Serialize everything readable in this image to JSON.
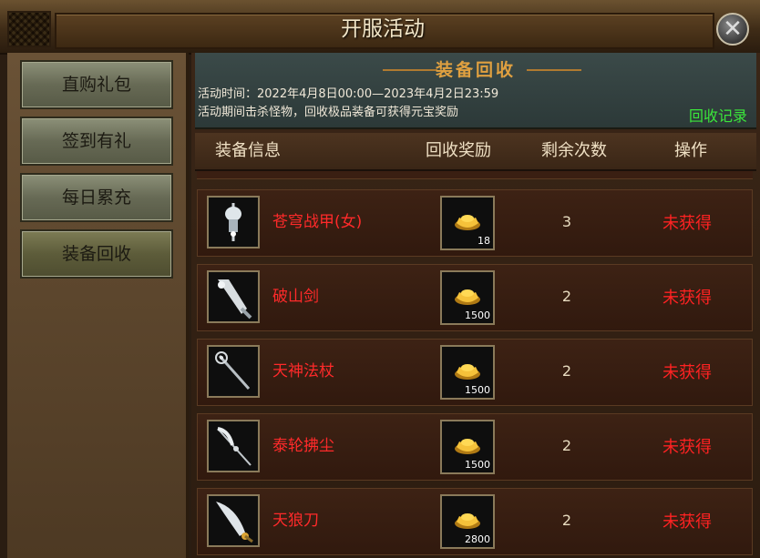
{
  "window": {
    "title": "开服活动"
  },
  "sidebar": {
    "items": [
      {
        "label": "直购礼包",
        "active": false
      },
      {
        "label": "签到有礼",
        "active": false
      },
      {
        "label": "每日累充",
        "active": false
      },
      {
        "label": "装备回收",
        "active": true
      }
    ]
  },
  "banner": {
    "title": "装备回收",
    "time_text": "活动时间：2022年4月8日00:00—2023年4月2日23:59",
    "desc_text": "活动期间击杀怪物，回收极品装备可获得元宝奖励",
    "record_link": "回收记录"
  },
  "table": {
    "headers": [
      "装备信息",
      "回收奖励",
      "剩余次数",
      "操作"
    ],
    "rows": [
      {
        "name": "苍穹战甲(女)",
        "reward": "18",
        "remaining": "3",
        "status": "未获得",
        "icon": "armor-icon"
      },
      {
        "name": "破山剑",
        "reward": "1500",
        "remaining": "2",
        "status": "未获得",
        "icon": "sword-icon"
      },
      {
        "name": "天神法杖",
        "reward": "1500",
        "remaining": "2",
        "status": "未获得",
        "icon": "staff-icon"
      },
      {
        "name": "泰轮拂尘",
        "reward": "1500",
        "remaining": "2",
        "status": "未获得",
        "icon": "whisk-icon"
      },
      {
        "name": "天狼刀",
        "reward": "2800",
        "remaining": "2",
        "status": "未获得",
        "icon": "blade-icon"
      }
    ]
  },
  "colors": {
    "accent_gold": "#e0a040",
    "status_red": "#ff2222",
    "link_green": "#3be63b",
    "item_red": "#ff2a2a"
  }
}
